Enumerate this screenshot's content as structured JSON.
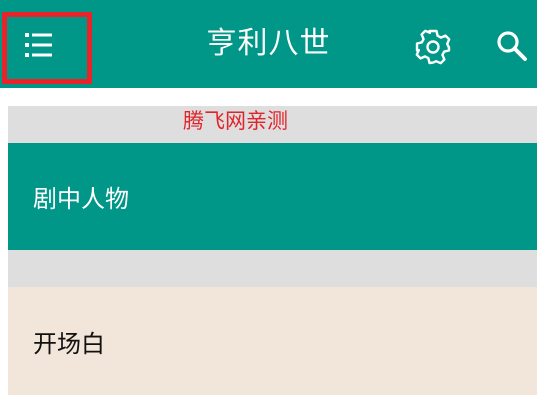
{
  "app_bar": {
    "title": "亨利八世",
    "background": "#009688",
    "menu_icon": "menu-list-icon",
    "settings_icon": "gear-icon",
    "search_icon": "search-icon",
    "highlight_color": "#e8232a"
  },
  "watermark": {
    "text": "腾飞网亲测",
    "color": "#e0242a"
  },
  "list": {
    "items": [
      {
        "label": "剧中人物",
        "background": "#009688",
        "text_color": "#ffffff"
      },
      {
        "label": "开场白",
        "background": "#f1e6d9",
        "text_color": "#111111"
      }
    ]
  }
}
